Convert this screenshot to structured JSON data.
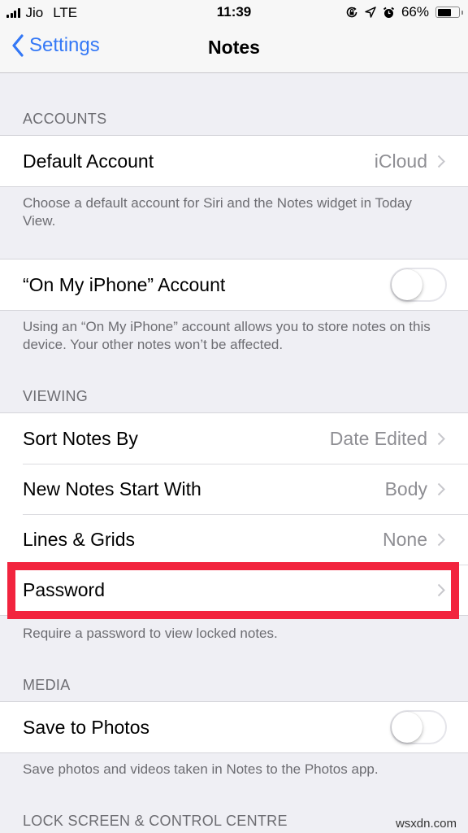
{
  "status_bar": {
    "carrier": "Jio",
    "network": "LTE",
    "time": "11:39",
    "icons": [
      "signal-icon",
      "orientation-lock-icon",
      "location-icon",
      "alarm-icon",
      "battery-icon"
    ],
    "battery_percent_label": "66%",
    "battery_level": 0.66
  },
  "nav": {
    "back_label": "Settings",
    "title": "Notes"
  },
  "sections": {
    "accounts": {
      "header": "ACCOUNTS",
      "default_account": {
        "label": "Default Account",
        "value": "iCloud"
      },
      "default_account_footer": "Choose a default account for Siri and the Notes widget in Today View.",
      "on_my_iphone": {
        "label": "“On My iPhone” Account",
        "on": false
      },
      "on_my_iphone_footer": "Using an “On My iPhone” account allows you to store notes on this device. Your other notes won’t be affected."
    },
    "viewing": {
      "header": "VIEWING",
      "rows": [
        {
          "label": "Sort Notes By",
          "value": "Date Edited"
        },
        {
          "label": "New Notes Start With",
          "value": "Body"
        },
        {
          "label": "Lines & Grids",
          "value": "None"
        },
        {
          "label": "Password",
          "value": ""
        }
      ],
      "footer": "Require a password to view locked notes."
    },
    "media": {
      "header": "MEDIA",
      "save_to_photos": {
        "label": "Save to Photos",
        "on": false
      },
      "footer": "Save photos and videos taken in Notes to the Photos app."
    },
    "lock_screen": {
      "header": "LOCK SCREEN & CONTROL CENTRE"
    }
  },
  "annotation": {
    "highlight_color": "#f2243e",
    "highlighted_row": "Password"
  },
  "watermark": "wsxdn.com"
}
